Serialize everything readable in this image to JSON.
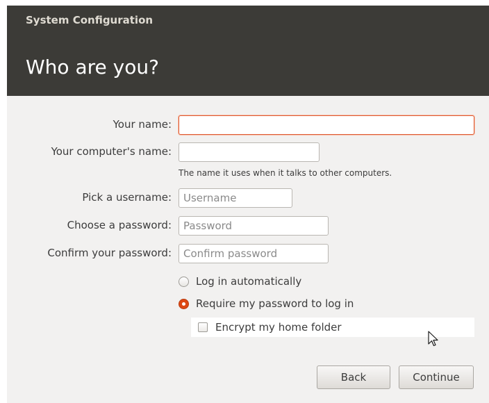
{
  "window": {
    "title": "System Configuration",
    "page_title": "Who are you?"
  },
  "form": {
    "name": {
      "label": "Your name:",
      "value": "",
      "placeholder": "",
      "focused": true
    },
    "computer_name": {
      "label": "Your computer's name:",
      "value": "",
      "placeholder": "",
      "hint": "The name it uses when it talks to other computers."
    },
    "username": {
      "label": "Pick a username:",
      "value": "",
      "placeholder": "Username"
    },
    "password": {
      "label": "Choose a password:",
      "value": "",
      "placeholder": "Password"
    },
    "confirm_password": {
      "label": "Confirm your password:",
      "value": "",
      "placeholder": "Confirm password"
    }
  },
  "login_options": [
    {
      "label": "Log in automatically",
      "checked": false
    },
    {
      "label": "Require my password to log in",
      "checked": true
    }
  ],
  "encrypt": {
    "label": "Encrypt my home folder",
    "checked": false
  },
  "buttons": {
    "back": "Back",
    "continue": "Continue"
  },
  "colors": {
    "header_bg": "#3c3b37",
    "window_bg": "#f2f1f0",
    "accent": "#dd4814",
    "focus_border": "#dd5a32"
  },
  "icons": {
    "pointer": "mouse-pointer-icon",
    "radio_on": "radio-checked-icon",
    "radio_off": "radio-unchecked-icon",
    "checkbox_off": "checkbox-unchecked-icon"
  }
}
